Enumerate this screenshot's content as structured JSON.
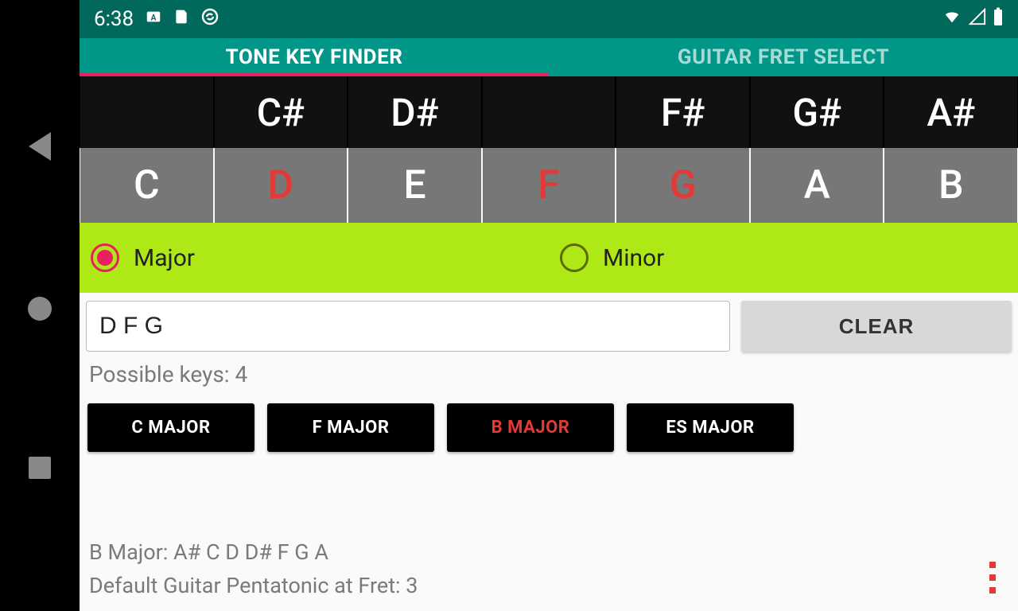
{
  "status": {
    "time": "6:38"
  },
  "tabs": {
    "tone_key_finder": "TONE KEY FINDER",
    "guitar_fret_select": "GUITAR FRET SELECT",
    "active": 0
  },
  "sharps": [
    "",
    "C#",
    "D#",
    "",
    "F#",
    "G#",
    "A#"
  ],
  "naturals": [
    {
      "n": "C",
      "sel": false
    },
    {
      "n": "D",
      "sel": true
    },
    {
      "n": "E",
      "sel": false
    },
    {
      "n": "F",
      "sel": true
    },
    {
      "n": "G",
      "sel": true
    },
    {
      "n": "A",
      "sel": false
    },
    {
      "n": "B",
      "sel": false
    }
  ],
  "mode": {
    "major": "Major",
    "minor": "Minor",
    "selected": "major"
  },
  "input": {
    "value": "D F G"
  },
  "clear_label": "CLEAR",
  "possible_label": "Possible keys: 4",
  "keys": [
    {
      "label": "C MAJOR",
      "hi": false
    },
    {
      "label": "F MAJOR",
      "hi": false
    },
    {
      "label": "B MAJOR",
      "hi": true
    },
    {
      "label": "ES MAJOR",
      "hi": false
    }
  ],
  "footer": {
    "line1": "B Major: A# C D D# F G A",
    "line2": "Default Guitar Pentatonic at Fret: 3"
  }
}
